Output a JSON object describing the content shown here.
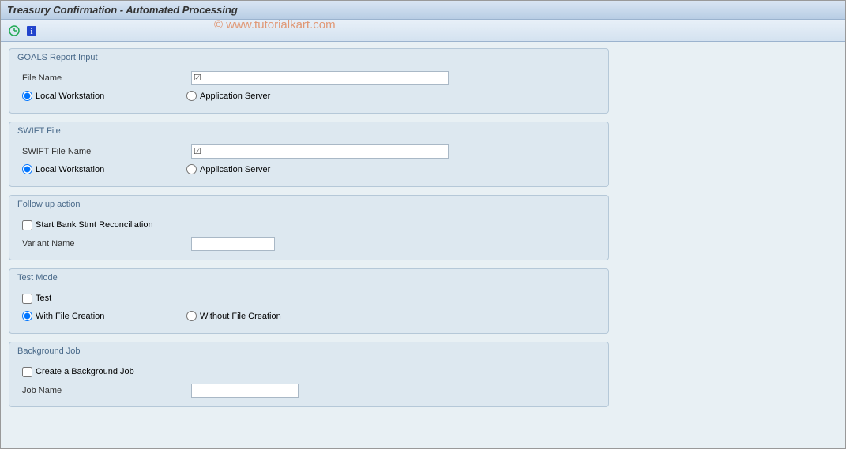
{
  "title": "Treasury Confirmation - Automated Processing",
  "watermark": "© www.tutorialkart.com",
  "toolbar": {
    "execute_icon": "execute",
    "info_icon": "info"
  },
  "groups": {
    "goals": {
      "title": "GOALS Report Input",
      "file_name_label": "File Name",
      "file_name_value": "",
      "radio_local": "Local Workstation",
      "radio_server": "Application Server"
    },
    "swift": {
      "title": "SWIFT File",
      "file_name_label": "SWIFT File Name",
      "file_name_value": "",
      "radio_local": "Local Workstation",
      "radio_server": "Application Server"
    },
    "followup": {
      "title": "Follow up action",
      "check_label": "Start Bank Stmt Reconciliation",
      "variant_label": "Variant Name",
      "variant_value": ""
    },
    "testmode": {
      "title": "Test Mode",
      "check_label": "Test",
      "radio_with": "With File Creation",
      "radio_without": "Without File Creation"
    },
    "bgjob": {
      "title": "Background Job",
      "check_label": "Create a Background Job",
      "job_label": "Job Name",
      "job_value": ""
    }
  }
}
